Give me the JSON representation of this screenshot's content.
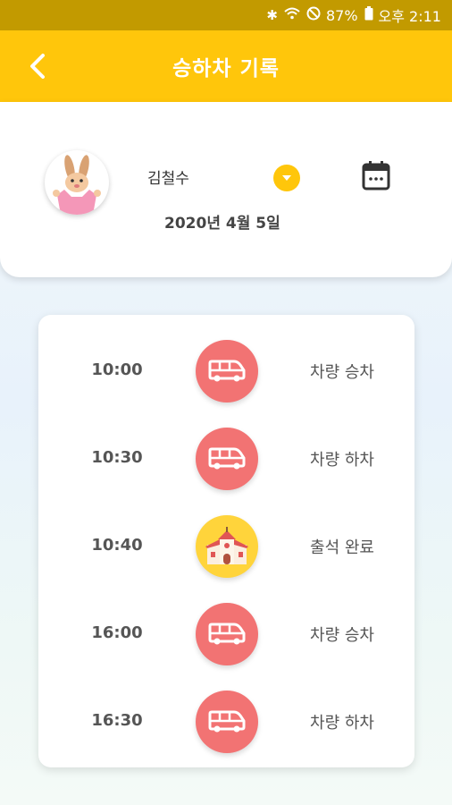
{
  "status_bar": {
    "battery": "87%",
    "time": "오후 2:11"
  },
  "app_bar": {
    "title": "승하차 기록",
    "back_icon": "chevron-left-icon"
  },
  "profile": {
    "child_name": "김철수",
    "date": "2020년 4월 5일",
    "dropdown_icon": "chevron-down-icon",
    "calendar_icon": "calendar-icon"
  },
  "colors": {
    "accent": "#ffc60b",
    "status_bar": "#c29a00",
    "bus": "#f27373",
    "attendance": "#ffd43b"
  },
  "records": [
    {
      "time": "10:00",
      "label": "차량 승차",
      "icon": "bus-icon"
    },
    {
      "time": "10:30",
      "label": "차량 하차",
      "icon": "bus-icon"
    },
    {
      "time": "10:40",
      "label": "출석 완료",
      "icon": "school-icon"
    },
    {
      "time": "16:00",
      "label": "차량 승차",
      "icon": "bus-icon"
    },
    {
      "time": "16:30",
      "label": "차량 하차",
      "icon": "bus-icon"
    }
  ]
}
